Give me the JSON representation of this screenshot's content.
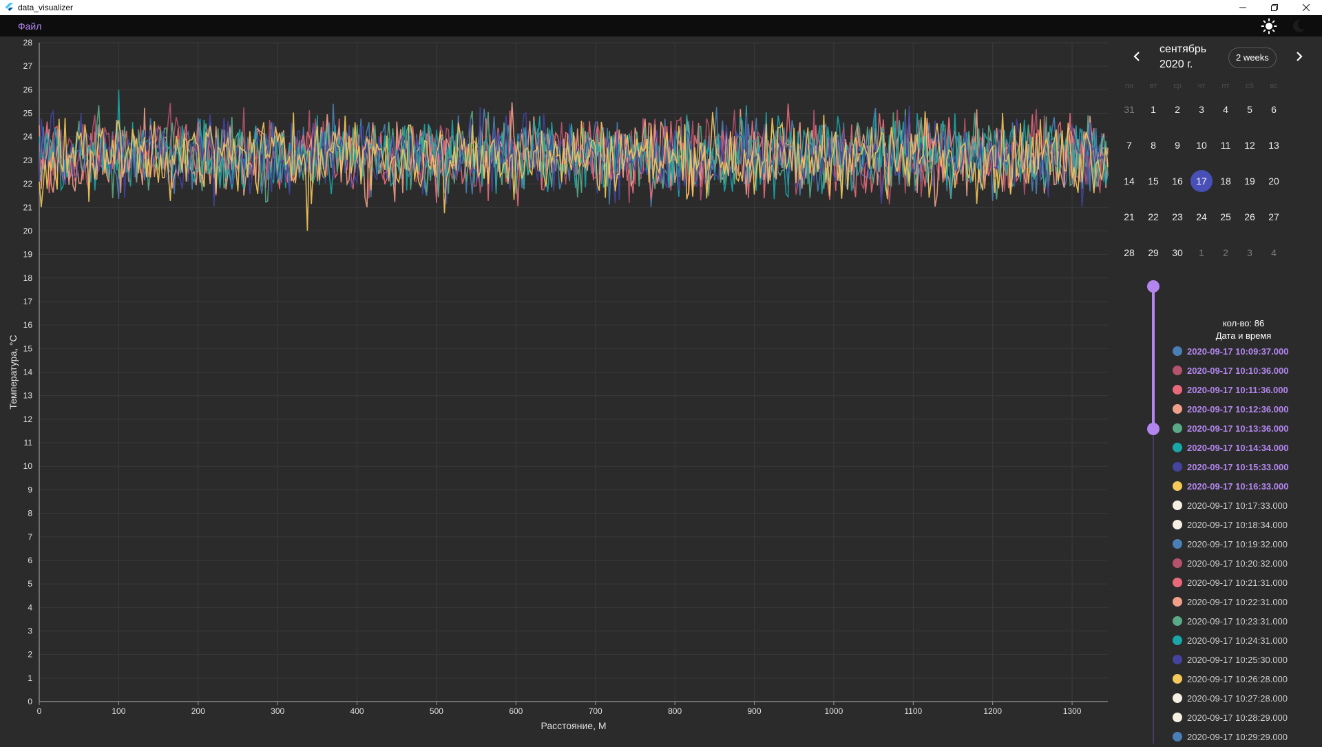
{
  "window": {
    "title": "data_visualizer"
  },
  "menu": {
    "file_label": "Файл"
  },
  "chart_data": {
    "type": "line",
    "xlabel": "Расстояние, М",
    "ylabel": "Температура, °С",
    "xlim": [
      0,
      1345
    ],
    "ylim": [
      0,
      28
    ],
    "x_ticks": [
      0,
      100,
      200,
      300,
      400,
      500,
      600,
      700,
      800,
      900,
      1000,
      1100,
      1200,
      1300
    ],
    "y_ticks": [
      0,
      1,
      2,
      3,
      4,
      5,
      6,
      7,
      8,
      9,
      10,
      11,
      12,
      13,
      14,
      15,
      16,
      17,
      18,
      19,
      20,
      21,
      22,
      23,
      24,
      25,
      26,
      27,
      28
    ],
    "grid": true,
    "series_count": 8,
    "series_colors": [
      "#4a7fb5",
      "#b5536e",
      "#e86a7a",
      "#f0a08a",
      "#5aaa88",
      "#18a6a8",
      "#4444a0",
      "#f5c85a"
    ],
    "approx_value_range": [
      20,
      26
    ],
    "approx_mean": 23.2,
    "approx_noise_amplitude": 1.0
  },
  "calendar": {
    "month_title": "сентябрь 2020 г.",
    "format_button": "2 weeks",
    "weekdays": [
      "пн",
      "вт",
      "ср",
      "чт",
      "пт",
      "сб",
      "вс"
    ],
    "weeks": [
      [
        {
          "d": "31",
          "o": 1
        },
        {
          "d": "1"
        },
        {
          "d": "2"
        },
        {
          "d": "3"
        },
        {
          "d": "4"
        },
        {
          "d": "5"
        },
        {
          "d": "6"
        }
      ],
      [
        {
          "d": "7"
        },
        {
          "d": "8"
        },
        {
          "d": "9"
        },
        {
          "d": "10"
        },
        {
          "d": "11"
        },
        {
          "d": "12"
        },
        {
          "d": "13"
        }
      ],
      [
        {
          "d": "14"
        },
        {
          "d": "15"
        },
        {
          "d": "16"
        },
        {
          "d": "17",
          "s": 1
        },
        {
          "d": "18"
        },
        {
          "d": "19"
        },
        {
          "d": "20"
        }
      ],
      [
        {
          "d": "21"
        },
        {
          "d": "22"
        },
        {
          "d": "23"
        },
        {
          "d": "24"
        },
        {
          "d": "25"
        },
        {
          "d": "26"
        },
        {
          "d": "27"
        }
      ],
      [
        {
          "d": "28"
        },
        {
          "d": "29"
        },
        {
          "d": "30"
        },
        {
          "d": "1",
          "o": 1
        },
        {
          "d": "2",
          "o": 1
        },
        {
          "d": "3",
          "o": 1
        },
        {
          "d": "4",
          "o": 1
        }
      ]
    ]
  },
  "selection": {
    "count_label": "кол-во: 86",
    "header": "Дата и время",
    "items": [
      {
        "t": "2020-09-17 10:09:37.000",
        "c": "#4a7fb5",
        "a": true
      },
      {
        "t": "2020-09-17 10:10:36.000",
        "c": "#b5536e",
        "a": true
      },
      {
        "t": "2020-09-17 10:11:36.000",
        "c": "#e86a7a",
        "a": true
      },
      {
        "t": "2020-09-17 10:12:36.000",
        "c": "#f0a08a",
        "a": true
      },
      {
        "t": "2020-09-17 10:13:36.000",
        "c": "#5aaa88",
        "a": true
      },
      {
        "t": "2020-09-17 10:14:34.000",
        "c": "#18a6a8",
        "a": true
      },
      {
        "t": "2020-09-17 10:15:33.000",
        "c": "#4444a0",
        "a": true
      },
      {
        "t": "2020-09-17 10:16:33.000",
        "c": "#f5c85a",
        "a": true
      },
      {
        "t": "2020-09-17 10:17:33.000",
        "c": "#f6f0e4",
        "a": false
      },
      {
        "t": "2020-09-17 10:18:34.000",
        "c": "#f6f0e4",
        "a": false
      },
      {
        "t": "2020-09-17 10:19:32.000",
        "c": "#4a7fb5",
        "a": false
      },
      {
        "t": "2020-09-17 10:20:32.000",
        "c": "#b5536e",
        "a": false
      },
      {
        "t": "2020-09-17 10:21:31.000",
        "c": "#e86a7a",
        "a": false
      },
      {
        "t": "2020-09-17 10:22:31.000",
        "c": "#f0a08a",
        "a": false
      },
      {
        "t": "2020-09-17 10:23:31.000",
        "c": "#5aaa88",
        "a": false
      },
      {
        "t": "2020-09-17 10:24:31.000",
        "c": "#18a6a8",
        "a": false
      },
      {
        "t": "2020-09-17 10:25:30.000",
        "c": "#4444a0",
        "a": false
      },
      {
        "t": "2020-09-17 10:26:28.000",
        "c": "#f5c85a",
        "a": false
      },
      {
        "t": "2020-09-17 10:27:28.000",
        "c": "#f6f0e4",
        "a": false
      },
      {
        "t": "2020-09-17 10:28:29.000",
        "c": "#f6f0e4",
        "a": false
      },
      {
        "t": "2020-09-17 10:29:29.000",
        "c": "#4a7fb5",
        "a": false
      }
    ]
  },
  "colors": {
    "accent": "#b286ee",
    "selected_day": "#4850b8",
    "background": "#2b2b2b",
    "grid": "#3b3b3b"
  }
}
